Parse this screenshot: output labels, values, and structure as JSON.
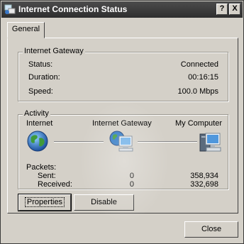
{
  "window": {
    "title": "Internet Connection Status",
    "help_button": "?",
    "close_button": "X"
  },
  "tabs": [
    {
      "label": "General"
    }
  ],
  "gateway_group": {
    "title": "Internet Gateway",
    "status_label": "Status:",
    "status_value": "Connected",
    "duration_label": "Duration:",
    "duration_value": "00:16:15",
    "speed_label": "Speed:",
    "speed_value": "100.0 Mbps"
  },
  "activity_group": {
    "title": "Activity",
    "nodes": {
      "internet": "Internet",
      "gateway": "Internet Gateway",
      "computer": "My Computer"
    },
    "packets_label": "Packets:",
    "sent_label": "Sent:",
    "received_label": "Received:",
    "sent_gateway": "0",
    "received_gateway": "0",
    "sent_computer": "358,934",
    "received_computer": "332,698"
  },
  "buttons": {
    "properties": "Properties",
    "disable": "Disable",
    "close": "Close"
  },
  "colors": {
    "titlebar": "#3a3a3a",
    "face": "#d4d0c8"
  },
  "icons": [
    "network-status-icon",
    "globe-icon",
    "gateway-computer-icon",
    "computer-icon"
  ]
}
